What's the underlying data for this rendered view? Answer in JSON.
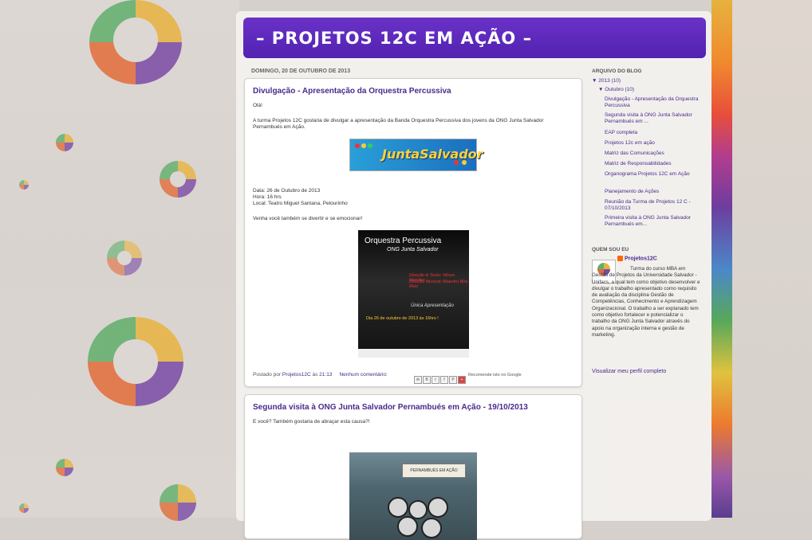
{
  "blog": {
    "title": "– PROJETOS 12C EM AÇÃO –"
  },
  "date_header": "DOMINGO, 20 DE OUTUBRO DE 2013",
  "posts": [
    {
      "title": "Divulgação - Apresentação da Orquestra Percussiva",
      "greeting": "Olá!",
      "intro": "A turma Projetos 12C gostaria de divulgar a apresentação da Banda Orquestra Percussiva dos jovens da ONG Junta Salvador Pernambués em Ação.",
      "banner_text": "JuntaSalvador",
      "details": [
        "Data: 26 de Outubro de 2013",
        "Hora: 16 hrs",
        "Local: Teatro Miguel Santana, Pelourinho"
      ],
      "closing": "Venha você também se divertir e se emocionar!",
      "poster": {
        "title": "Orquestra Percussiva",
        "subtitle": "ONG Junta Salvador",
        "credit1": "Direção & Texto: Nilson Mendes",
        "credit2": "Direção Musical: Maestro Bira Reis",
        "unica": "Única Apresentação",
        "date": "Dia 26 de outubro de 2013 às 16hrs !"
      },
      "footer": {
        "posted_by_label": "Postado por",
        "author": "Projetos12C",
        "at_label": "às",
        "time": "21:13",
        "comments": "Nenhum comentário:",
        "recommend": "Recomende isto no Google"
      }
    },
    {
      "title": "Segunda visita à ONG Junta Salvador Pernambués em Ação - 19/10/2013",
      "text": "E você? Também gostaria de abraçar esta causa?!",
      "photo_sign": "PERNAMBUÉS EM AÇÃO"
    }
  ],
  "sidebar": {
    "archive_title": "ARQUIVO DO BLOG",
    "year": "▼  2013 (10)",
    "month": "▼  Outubro (10)",
    "items": [
      "Divulgação - Apresentação da Orquestra Percussiva",
      "Segunda visita à ONG Junta Salvador Pernambués em ...",
      "EAP completa",
      "Projetos 12c em ação",
      "Matriz das Comunicações",
      "Matriz de Responsabilidades",
      "Organograma Projetos 12C em Ação",
      "Planejamento de Ações",
      "Reunião da Turma de Projetos 12 C - 07/10/2013",
      "Primeira visita à ONG Junta Salvador Pernambués em..."
    ],
    "about_title": "QUEM SOU EU",
    "profile_name": "Projetos12C",
    "profile_text": "Turma do curso MBA em Gestão de Projetos da Universidade Salvador - Unifacs, a qual tem como objetivo desenvolver e divulgar o trabalho apresentado como requisito de avaliação da disciplina Gestão de Competências, Conhecimento e Aprendizagem Organizacional. O trabalho a ser explanado tem como objetivo fortalecer e potencializar o trabalho da ONG Junta Salvador através do apoio na organização interna e gestão de marketing.",
    "profile_link": "Visualizar meu perfil completo"
  },
  "colors": {
    "header": "#5a28b8",
    "link": "#4a2a8c"
  }
}
